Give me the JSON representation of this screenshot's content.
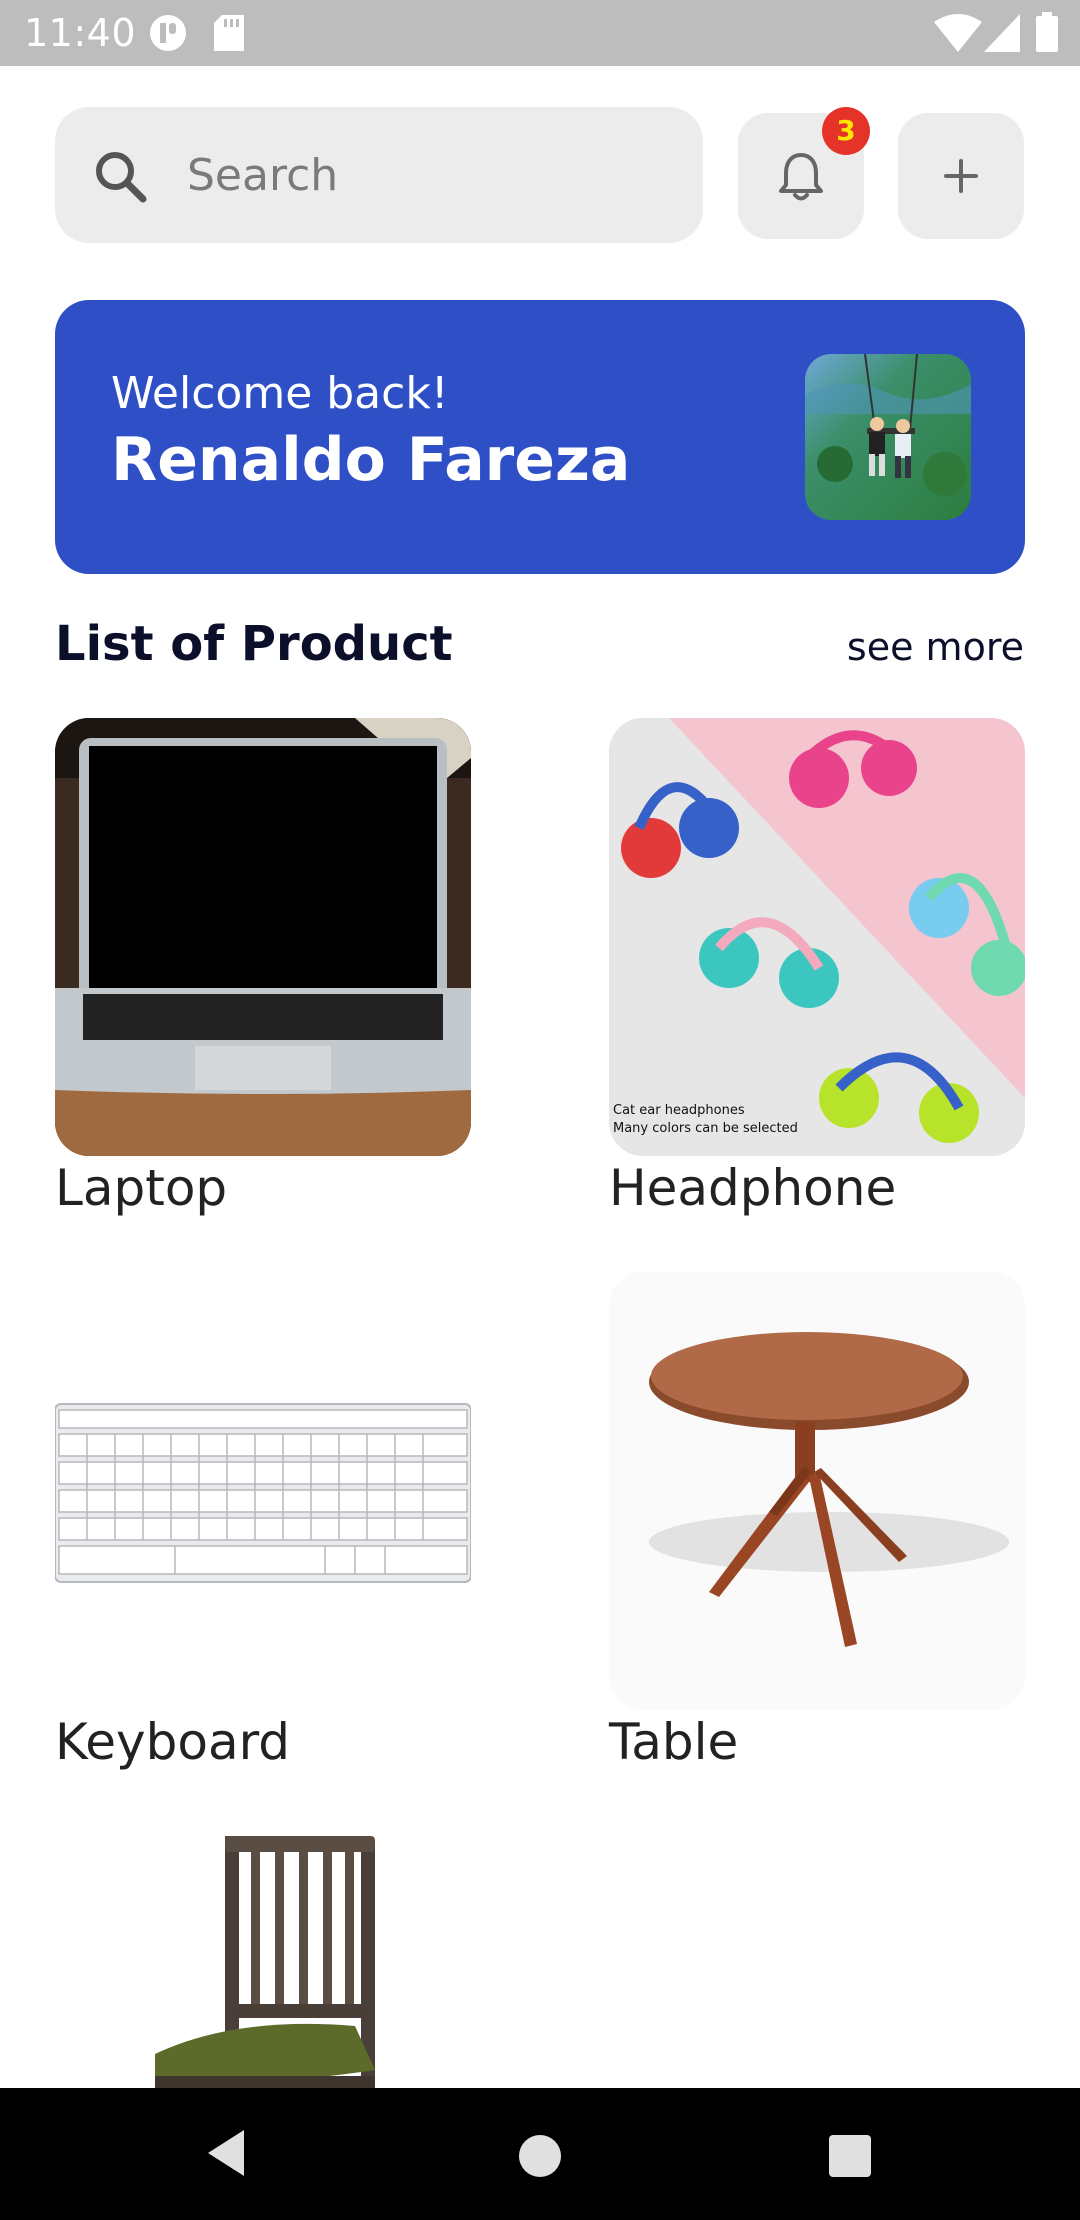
{
  "status_bar": {
    "time": "11:40",
    "icons": [
      "app-notification-icon",
      "sd-card-icon",
      "wifi-icon",
      "signal-icon",
      "battery-icon"
    ]
  },
  "search": {
    "placeholder": "Search"
  },
  "notifications": {
    "badge_count": "3"
  },
  "welcome": {
    "greeting": "Welcome back!",
    "name": "Renaldo Fareza"
  },
  "products_section": {
    "title": "List of Product",
    "see_more": "see more",
    "items": [
      {
        "label": "Laptop"
      },
      {
        "label": "Headphone",
        "image_caption_1": "Cat ear headphones",
        "image_caption_2": "Many colors can be selected"
      },
      {
        "label": "Keyboard"
      },
      {
        "label": "Table"
      },
      {
        "label": ""
      }
    ]
  },
  "nav_bar": {
    "icons": [
      "back-icon",
      "home-icon",
      "recents-icon"
    ]
  },
  "colors": {
    "accent": "#2f4fc7",
    "badge": "#e5332a",
    "surface": "#ececec"
  }
}
